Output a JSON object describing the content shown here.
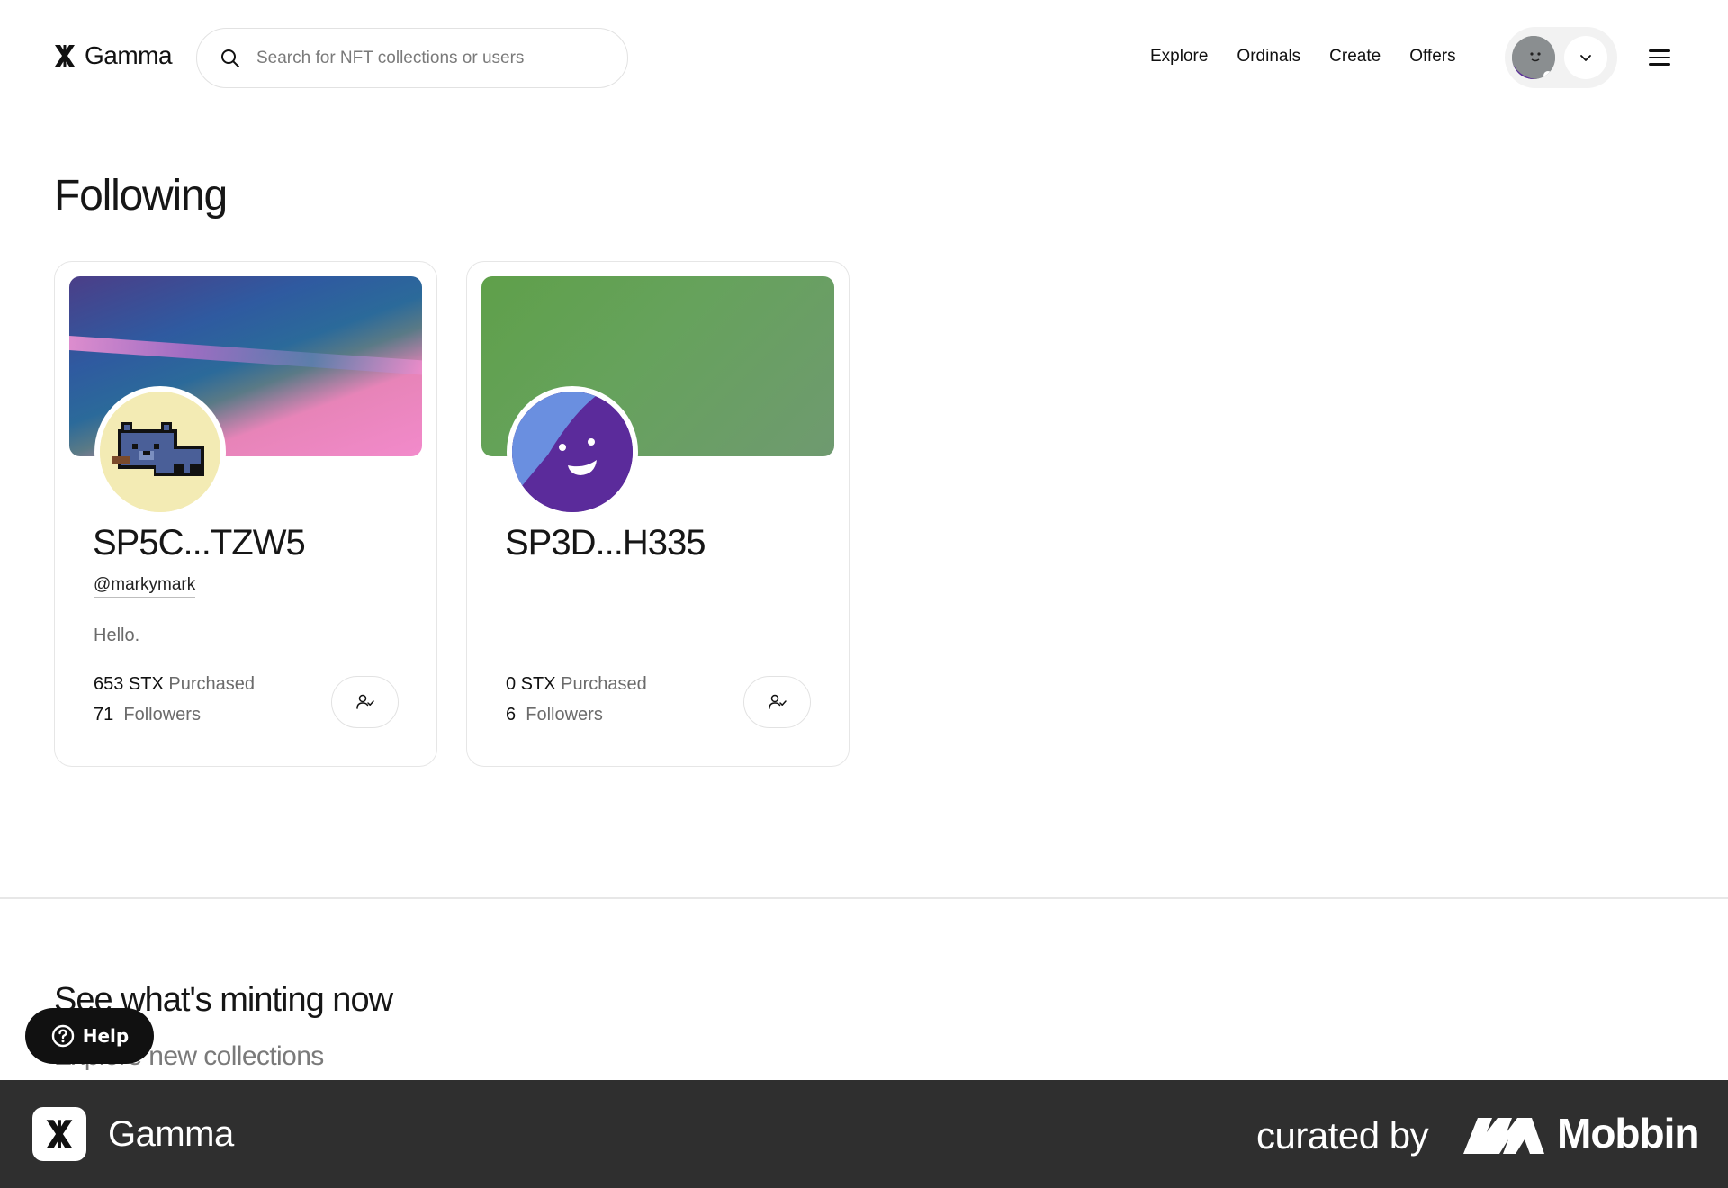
{
  "header": {
    "app_name": "Gamma",
    "search_placeholder": "Search for NFT collections or users",
    "nav": [
      {
        "label": "Explore"
      },
      {
        "label": "Ordinals"
      },
      {
        "label": "Create"
      },
      {
        "label": "Offers"
      }
    ]
  },
  "page": {
    "title": "Following"
  },
  "cards": [
    {
      "name": "SP5C...TZW5",
      "handle": "@markymark",
      "bio": "Hello.",
      "purchased_value": "653 STX",
      "purchased_label": "Purchased",
      "followers_count": "71",
      "followers_label": "Followers"
    },
    {
      "name": "SP3D...H335",
      "handle": "",
      "bio": "",
      "purchased_value": "0 STX",
      "purchased_label": "Purchased",
      "followers_count": "6",
      "followers_label": "Followers"
    }
  ],
  "minting": {
    "title": "See what's minting now",
    "subtitle": "Explore new collections"
  },
  "help": {
    "label": "Help"
  },
  "footer": {
    "app_name": "Gamma",
    "curated_by": "curated by",
    "brand": "Mobbin"
  },
  "colors": {
    "accent": "#161616",
    "footer_bg": "#2f2f2f",
    "card_border": "#e6e6e6"
  }
}
